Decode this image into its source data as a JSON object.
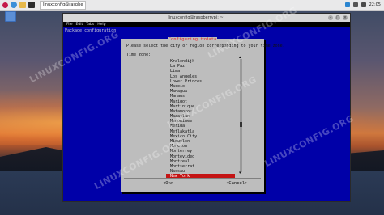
{
  "taskbar": {
    "task_label": "linuxconfig@raspbe",
    "clock": "22:05"
  },
  "terminal": {
    "title": "linuxconfig@raspberrypi: ~",
    "menu": [
      "File",
      "Edit",
      "Tabs",
      "Help"
    ],
    "package_line": "Package configuration"
  },
  "dialog": {
    "title": "Configuring tzdata",
    "prompt": "Please select the city or region corresponding to your time zone.",
    "label": "Time zone:",
    "items": [
      "Kralendijk",
      "La Paz",
      "Lima",
      "Los Angeles",
      "Lower Princes",
      "Maceio",
      "Managua",
      "Manaus",
      "Marigot",
      "Martinique",
      "Matamoros",
      "Mazatlan",
      "Menominee",
      "Merida",
      "Metlakatla",
      "Mexico City",
      "Miquelon",
      "Moncton",
      "Monterrey",
      "Montevideo",
      "Montreal",
      "Montserrat",
      "Nassau",
      "New York"
    ],
    "selected_index": 23,
    "ok_label": "<Ok>",
    "cancel_label": "<Cancel>"
  },
  "watermark": "LINUXCONFIG.ORG"
}
